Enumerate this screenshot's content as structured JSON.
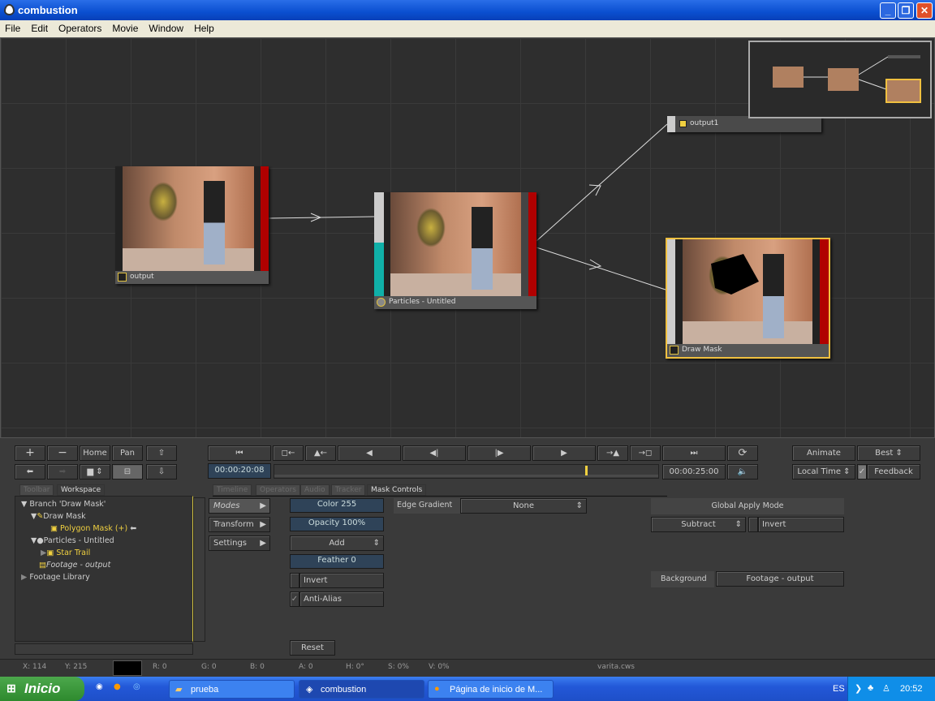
{
  "window": {
    "title": "combustion",
    "minimize": "_",
    "maximize": "❐",
    "close": "✕"
  },
  "menu": [
    "File",
    "Edit",
    "Operators",
    "Movie",
    "Window",
    "Help"
  ],
  "nodes": {
    "output": "output",
    "particles": "Particles - Untitled",
    "output1": "output1",
    "draw_mask": "Draw Mask"
  },
  "toolbar": {
    "plus": "+",
    "minus": "−",
    "home": "Home",
    "pan": "Pan"
  },
  "transport": {
    "current_time": "00:00:20:08",
    "end_time": "00:00:25:00",
    "progress": 0.81,
    "buttons": [
      "⏮",
      "◻←",
      "▲←",
      "◀",
      "◀|",
      "|▶",
      "▶",
      "→▲",
      "→◻",
      "⏭",
      "⟳"
    ]
  },
  "right_controls": {
    "animate": "Animate",
    "quality": "Best",
    "local_time": "Local Time",
    "feedback": "Feedback",
    "feedback_checked": true
  },
  "left_tabs": [
    "Toolbar",
    "Workspace"
  ],
  "tree": [
    {
      "label": "Branch 'Draw Mask'"
    },
    {
      "label": "Draw Mask"
    },
    {
      "label": "Polygon Mask (+)"
    },
    {
      "label": "Particles - Untitled"
    },
    {
      "label": "Star Trail"
    },
    {
      "label": "Footage - output"
    },
    {
      "label": "Footage Library"
    }
  ],
  "right_tabs": [
    "Timeline",
    "Operators",
    "Audio",
    "Tracker",
    "Mask Controls"
  ],
  "mask_controls": {
    "menu": [
      "Modes",
      "Transform",
      "Settings"
    ],
    "color": "Color 255",
    "opacity": "Opacity 100%",
    "blend": "Add",
    "feather": "Feather 0",
    "invert": "Invert",
    "anti_alias": "Anti-Alias",
    "anti_alias_checked": true,
    "reset": "Reset",
    "edge_gradient_label": "Edge Gradient",
    "edge_gradient_value": "None",
    "global_apply_mode": "Global Apply Mode",
    "apply_mode_value": "Subtract",
    "global_invert": "Invert",
    "background_label": "Background",
    "background_value": "Footage - output"
  },
  "status": {
    "x": "X:  114",
    "y": "Y:  215",
    "r": "R: 0",
    "g": "G: 0",
    "b": "B: 0",
    "a": "A: 0",
    "h": "H: 0°",
    "s": "S: 0%",
    "v": "V: 0%",
    "file": "varita.cws"
  },
  "taskbar": {
    "start": "Inicio",
    "tasks": [
      "prueba",
      "combustion",
      "Página de inicio de M..."
    ],
    "lang": "ES",
    "clock": "20:52"
  },
  "colors": {
    "accent": "#f0d040",
    "field": "#2f4358",
    "title": "#0a4fd0"
  }
}
